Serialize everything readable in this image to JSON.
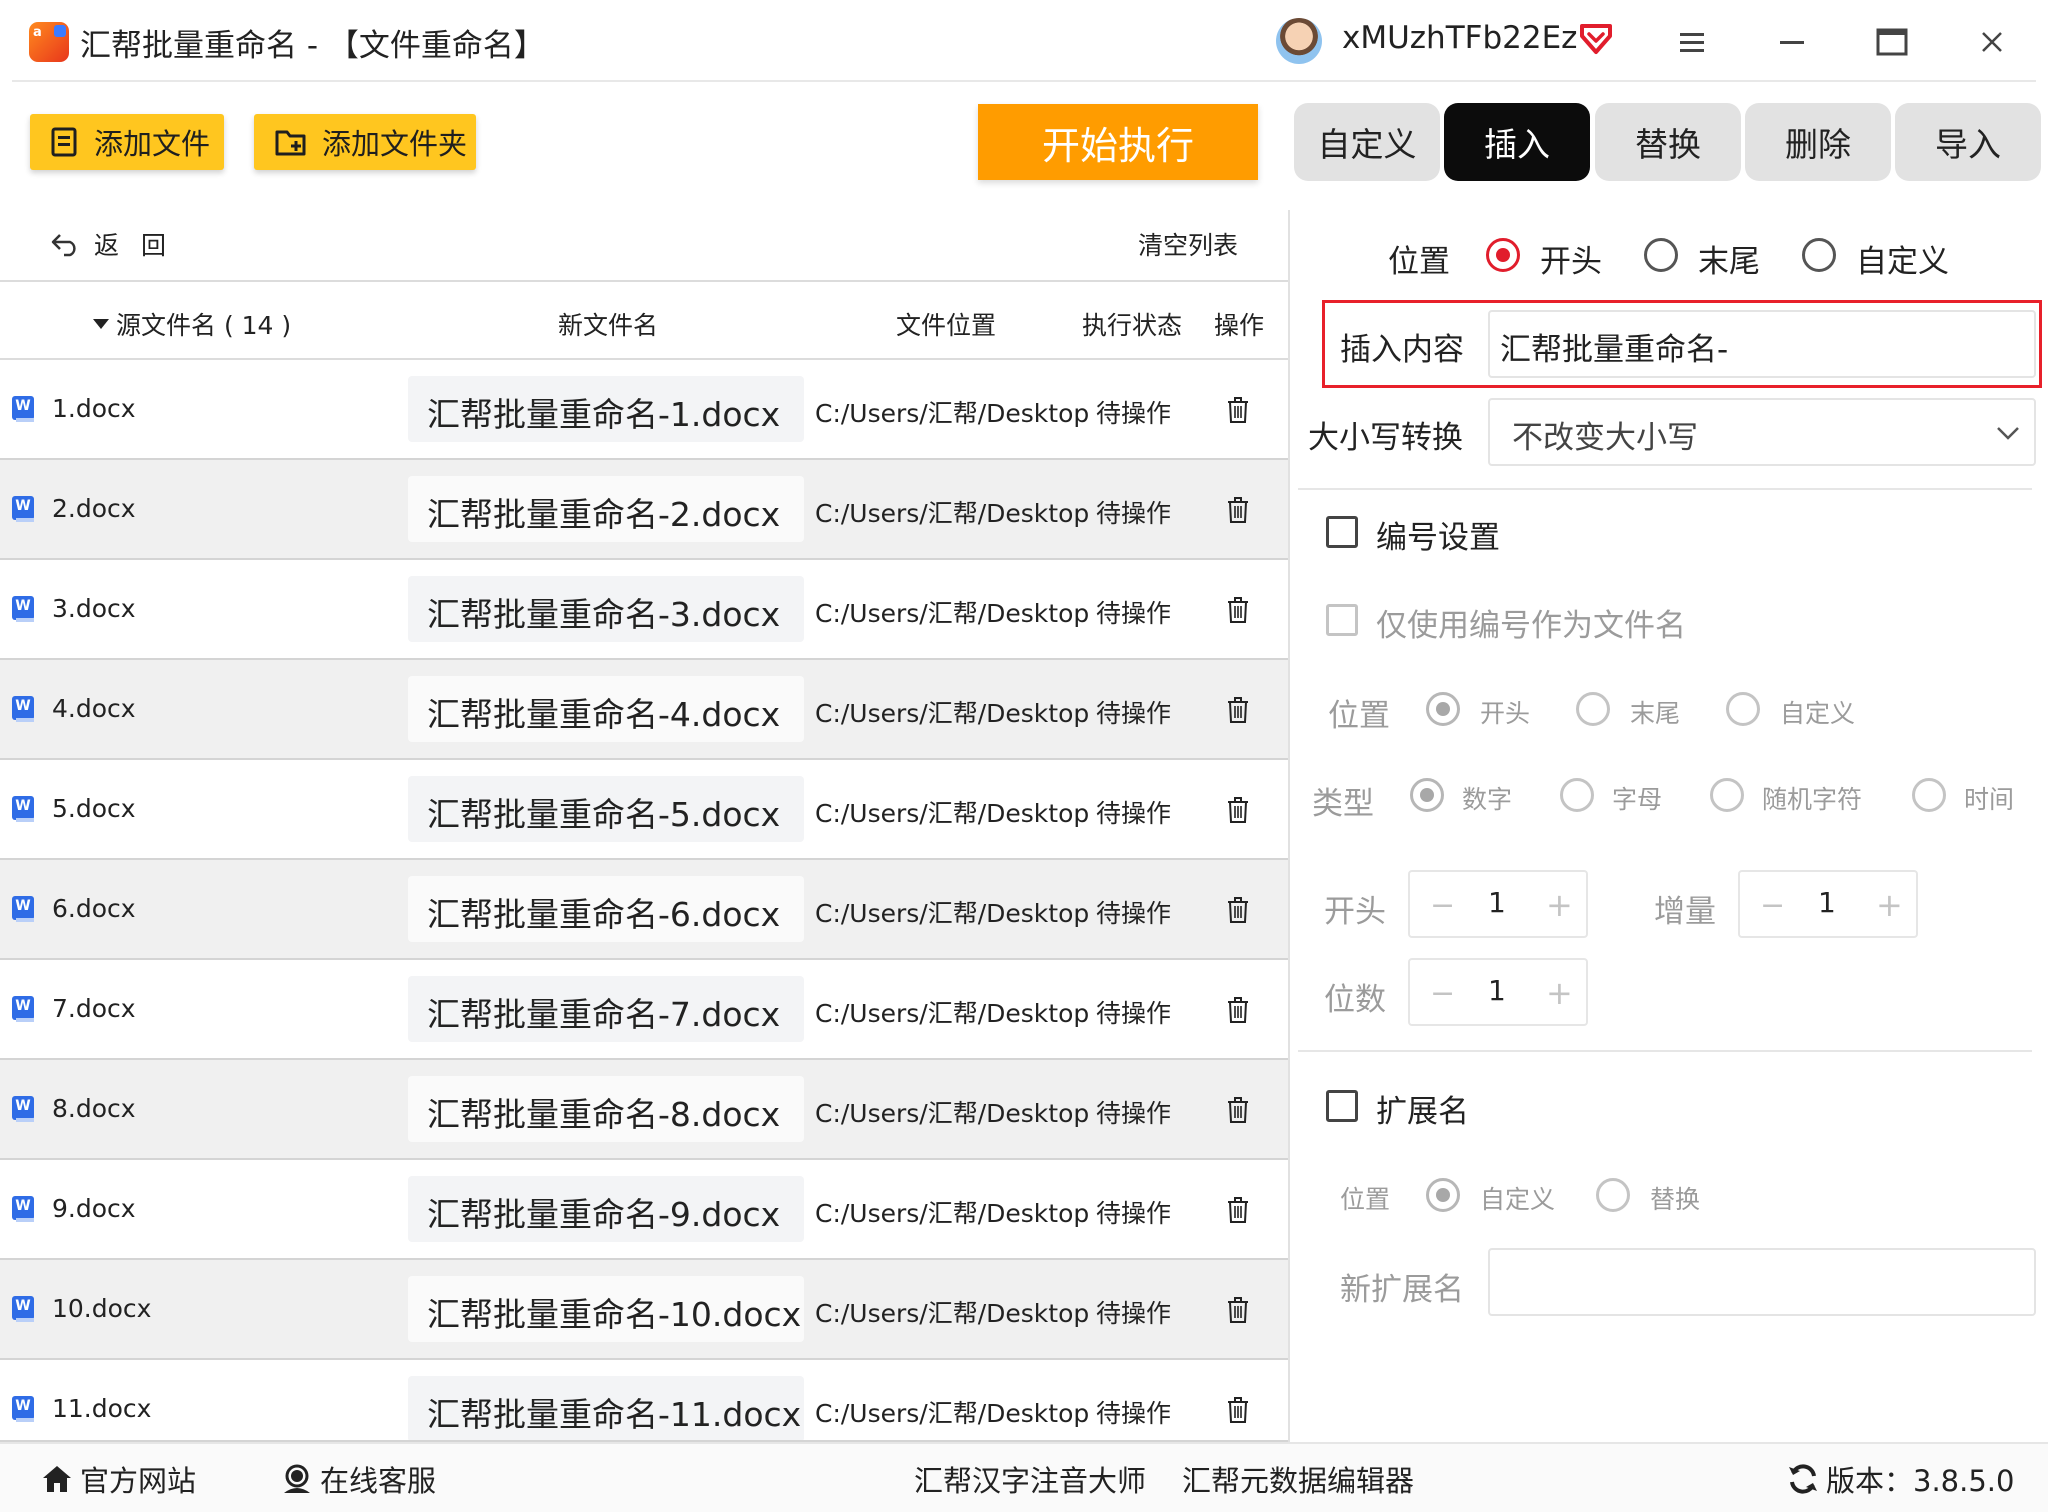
{
  "window": {
    "title": "汇帮批量重命名 - 【文件重命名】",
    "username": "xMUzhTFb22Ez"
  },
  "toolbar": {
    "add_file": "添加文件",
    "add_folder": "添加文件夹",
    "start": "开始执行"
  },
  "tabs": [
    {
      "label": "自定义",
      "active": false
    },
    {
      "label": "插入",
      "active": true
    },
    {
      "label": "替换",
      "active": false
    },
    {
      "label": "删除",
      "active": false
    },
    {
      "label": "导入",
      "active": false
    }
  ],
  "list": {
    "back": "返回",
    "clear": "清空列表",
    "columns": {
      "source": "源文件名 ( 14 )",
      "new_name": "新文件名",
      "location": "文件位置",
      "status": "执行状态",
      "action": "操作"
    },
    "rows": [
      {
        "src": "1.docx",
        "new": "汇帮批量重命名-1.docx",
        "loc": "C:/Users/汇帮/Desktop",
        "status": "待操作"
      },
      {
        "src": "2.docx",
        "new": "汇帮批量重命名-2.docx",
        "loc": "C:/Users/汇帮/Desktop",
        "status": "待操作"
      },
      {
        "src": "3.docx",
        "new": "汇帮批量重命名-3.docx",
        "loc": "C:/Users/汇帮/Desktop",
        "status": "待操作"
      },
      {
        "src": "4.docx",
        "new": "汇帮批量重命名-4.docx",
        "loc": "C:/Users/汇帮/Desktop",
        "status": "待操作"
      },
      {
        "src": "5.docx",
        "new": "汇帮批量重命名-5.docx",
        "loc": "C:/Users/汇帮/Desktop",
        "status": "待操作"
      },
      {
        "src": "6.docx",
        "new": "汇帮批量重命名-6.docx",
        "loc": "C:/Users/汇帮/Desktop",
        "status": "待操作"
      },
      {
        "src": "7.docx",
        "new": "汇帮批量重命名-7.docx",
        "loc": "C:/Users/汇帮/Desktop",
        "status": "待操作"
      },
      {
        "src": "8.docx",
        "new": "汇帮批量重命名-8.docx",
        "loc": "C:/Users/汇帮/Desktop",
        "status": "待操作"
      },
      {
        "src": "9.docx",
        "new": "汇帮批量重命名-9.docx",
        "loc": "C:/Users/汇帮/Desktop",
        "status": "待操作"
      },
      {
        "src": "10.docx",
        "new": "汇帮批量重命名-10.docx",
        "loc": "C:/Users/汇帮/Desktop",
        "status": "待操作"
      },
      {
        "src": "11.docx",
        "new": "汇帮批量重命名-11.docx",
        "loc": "C:/Users/汇帮/Desktop",
        "status": "待操作"
      }
    ]
  },
  "insert": {
    "position_label": "位置",
    "pos_start": "开头",
    "pos_end": "末尾",
    "pos_custom": "自定义",
    "content_label": "插入内容",
    "content_value": "汇帮批量重命名-",
    "case_label": "大小写转换",
    "case_value": "不改变大小写"
  },
  "numbering": {
    "label": "编号设置",
    "only_number": "仅使用编号作为文件名",
    "position_label": "位置",
    "pos_start": "开头",
    "pos_end": "末尾",
    "pos_custom": "自定义",
    "type_label": "类型",
    "type_number": "数字",
    "type_letter": "字母",
    "type_random": "随机字符",
    "type_time": "时间",
    "start_label": "开头",
    "start_value": "1",
    "step_label": "增量",
    "step_value": "1",
    "digits_label": "位数",
    "digits_value": "1",
    "minus": "−",
    "plus": "+"
  },
  "extension": {
    "label": "扩展名",
    "position_label": "位置",
    "pos_custom": "自定义",
    "pos_replace": "替换",
    "new_ext_label": "新扩展名",
    "new_ext_value": ""
  },
  "footer": {
    "website": "官方网站",
    "support": "在线客服",
    "pinyin": "汇帮汉字注音大师",
    "metadata": "汇帮元数据编辑器",
    "version": "版本：3.8.5.0"
  },
  "colors": {
    "accent_orange": "#ff9c00",
    "button_yellow": "#ffc61f",
    "radio_red": "#e11d2c",
    "highlight_red": "#e8202a"
  }
}
